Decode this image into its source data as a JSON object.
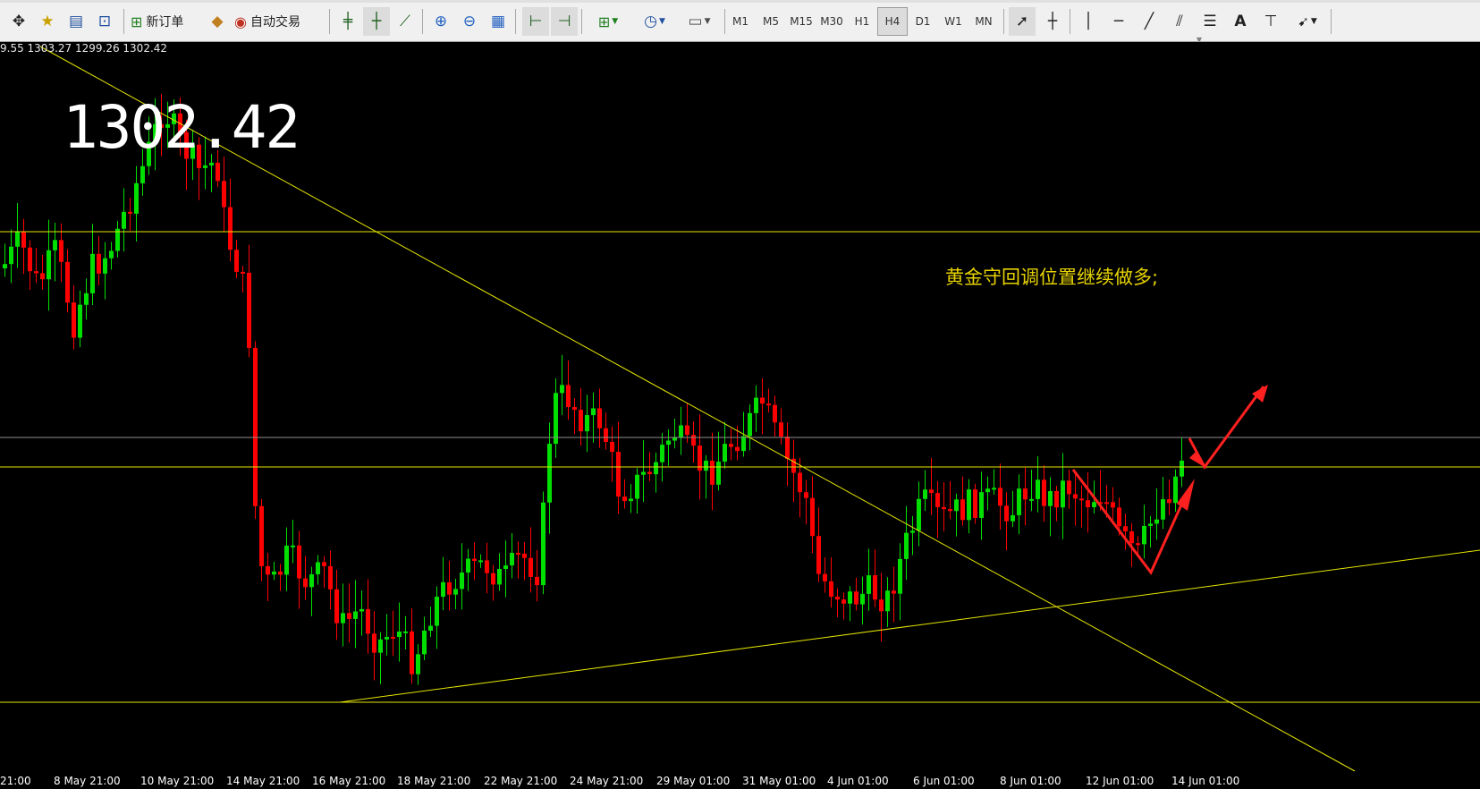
{
  "toolbar": {
    "new_order_label": "新订单",
    "auto_trade_label": "自动交易",
    "timeframes": [
      "M1",
      "M5",
      "M15",
      "M30",
      "H1",
      "H4",
      "D1",
      "W1",
      "MN"
    ],
    "active_timeframe": "H4"
  },
  "chart": {
    "ohlc_text": "9.55 1303.27 1299.26 1302.42",
    "current_price": "1302.42",
    "annotation": "黄金守回调位置继续做多;",
    "x_labels": [
      "21:00",
      "8 May 21:00",
      "10 May 21:00",
      "14 May 21:00",
      "16 May 21:00",
      "18 May 21:00",
      "22 May 21:00",
      "24 May 21:00",
      "29 May 01:00",
      "31 May 01:00",
      "4 Jun 01:00",
      "6 Jun 01:00",
      "8 Jun 01:00",
      "12 Jun 01:00",
      "14 Jun 01:00"
    ],
    "colors": {
      "background": "#000000",
      "bull": "#00e000",
      "bear": "#ff0000",
      "trendline": "#e6e600",
      "level_gray": "#909090",
      "arrow": "#ff2020"
    }
  }
}
